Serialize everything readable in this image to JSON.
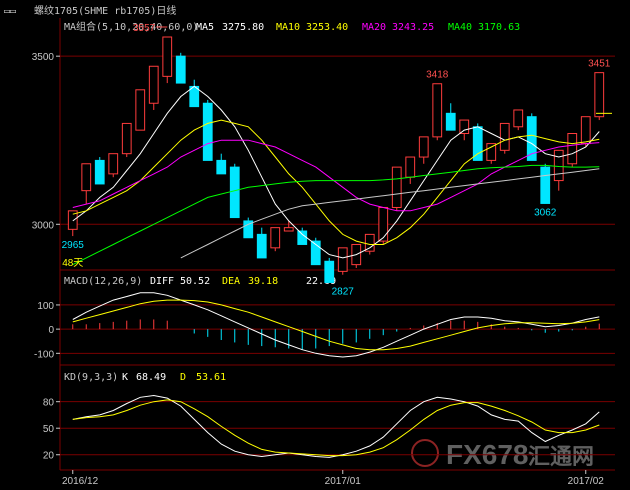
{
  "window": {
    "title": "螺纹1705(SHME rb1705)日线",
    "icon": "window-control-icon"
  },
  "colors": {
    "background": "#000000",
    "up": "#ff3c3c",
    "down": "#00e6ff",
    "grid": "#7a0000",
    "ma5": "#ffffff",
    "ma10": "#ffff00",
    "ma20": "#ff00ff",
    "ma40": "#00ff00",
    "axis_text": "#c8c8c8",
    "label_red": "#ff5050",
    "label_cyan": "#00e6ff"
  },
  "chart_data": [
    {
      "type": "candlestick",
      "title": "螺纹1705(SHME rb1705)日线",
      "ma_header": "MA组合(5,10,20,40,60,0)",
      "ma_values": [
        {
          "name": "MA5",
          "value": "3275.80",
          "color": "#ffffff"
        },
        {
          "name": "MA10",
          "value": "3253.40",
          "color": "#ffff00"
        },
        {
          "name": "MA20",
          "value": "3243.25",
          "color": "#ff00ff"
        },
        {
          "name": "MA40",
          "value": "3170.63",
          "color": "#00ff00"
        }
      ],
      "y_ticks": [
        3500,
        3000
      ],
      "ylim": [
        2870,
        3560
      ],
      "x_labels": [
        {
          "index": 0,
          "text": "2016/12"
        },
        {
          "index": 20,
          "text": "2017/01"
        },
        {
          "index": 38,
          "text": "2017/02"
        }
      ],
      "annotations": [
        {
          "index": 7,
          "value": 3557,
          "text": "3557",
          "color": "#ff5050",
          "arrow": true
        },
        {
          "index": 0,
          "value": 2965,
          "text": "2965",
          "color": "#00e6ff"
        },
        {
          "index": 20,
          "value": 2827,
          "text": "2827",
          "color": "#00e6ff"
        },
        {
          "index": 27,
          "value": 3418,
          "text": "3418",
          "color": "#ff5050"
        },
        {
          "index": 35,
          "value": 3062,
          "text": "3062",
          "color": "#00e6ff"
        },
        {
          "index": 39,
          "value": 3451,
          "text": "3451",
          "color": "#ff5050"
        },
        {
          "index": 0,
          "value": 2890,
          "text": "48天",
          "color": "#ffff00"
        }
      ],
      "candles": [
        {
          "o": 2985,
          "h": 3005,
          "c": 3040,
          "l": 2965
        },
        {
          "o": 3100,
          "h": 3150,
          "c": 3180,
          "l": 3060
        },
        {
          "o": 3190,
          "h": 3120,
          "c": 3120,
          "l": 3200
        },
        {
          "o": 3150,
          "h": 3200,
          "c": 3210,
          "l": 3140
        },
        {
          "o": 3210,
          "h": 3270,
          "c": 3300,
          "l": 3200
        },
        {
          "o": 3280,
          "h": 3370,
          "c": 3400,
          "l": 3280
        },
        {
          "o": 3360,
          "h": 3440,
          "c": 3470,
          "l": 3340
        },
        {
          "o": 3440,
          "h": 3510,
          "c": 3557,
          "l": 3420
        },
        {
          "o": 3500,
          "h": 3420,
          "c": 3420,
          "l": 3510
        },
        {
          "o": 3410,
          "h": 3350,
          "c": 3350,
          "l": 3430
        },
        {
          "o": 3360,
          "h": 3200,
          "c": 3190,
          "l": 3370
        },
        {
          "o": 3190,
          "h": 3160,
          "c": 3150,
          "l": 3210
        },
        {
          "o": 3170,
          "h": 3020,
          "c": 3020,
          "l": 3180
        },
        {
          "o": 3010,
          "h": 2960,
          "c": 2960,
          "l": 3020
        },
        {
          "o": 2970,
          "h": 2920,
          "c": 2900,
          "l": 2990
        },
        {
          "o": 2930,
          "h": 2970,
          "c": 2990,
          "l": 2920
        },
        {
          "o": 2980,
          "h": 2990,
          "c": 2990,
          "l": 3010
        },
        {
          "o": 2980,
          "h": 2950,
          "c": 2940,
          "l": 2990
        },
        {
          "o": 2950,
          "h": 2890,
          "c": 2880,
          "l": 2960
        },
        {
          "o": 2890,
          "h": 2850,
          "c": 2827,
          "l": 2900
        },
        {
          "o": 2860,
          "h": 2900,
          "c": 2930,
          "l": 2850
        },
        {
          "o": 2880,
          "h": 2920,
          "c": 2940,
          "l": 2870
        },
        {
          "o": 2920,
          "h": 2950,
          "c": 2970,
          "l": 2910
        },
        {
          "o": 2950,
          "h": 3030,
          "c": 3050,
          "l": 2940
        },
        {
          "o": 3050,
          "h": 3150,
          "c": 3170,
          "l": 3040
        },
        {
          "o": 3140,
          "h": 3180,
          "c": 3200,
          "l": 3120
        },
        {
          "o": 3200,
          "h": 3240,
          "c": 3260,
          "l": 3180
        },
        {
          "o": 3260,
          "h": 3320,
          "c": 3418,
          "l": 3250
        },
        {
          "o": 3330,
          "h": 3290,
          "c": 3280,
          "l": 3360
        },
        {
          "o": 3270,
          "h": 3300,
          "c": 3310,
          "l": 3250
        },
        {
          "o": 3290,
          "h": 3200,
          "c": 3190,
          "l": 3300
        },
        {
          "o": 3190,
          "h": 3210,
          "c": 3240,
          "l": 3180
        },
        {
          "o": 3220,
          "h": 3290,
          "c": 3300,
          "l": 3210
        },
        {
          "o": 3290,
          "h": 3310,
          "c": 3340,
          "l": 3280
        },
        {
          "o": 3320,
          "h": 3200,
          "c": 3190,
          "l": 3330
        },
        {
          "o": 3170,
          "h": 3120,
          "c": 3062,
          "l": 3180
        },
        {
          "o": 3130,
          "h": 3200,
          "c": 3220,
          "l": 3100
        },
        {
          "o": 3180,
          "h": 3250,
          "c": 3270,
          "l": 3170
        },
        {
          "o": 3240,
          "h": 3300,
          "c": 3320,
          "l": 3230
        },
        {
          "o": 3320,
          "h": 3440,
          "c": 3451,
          "l": 3310
        }
      ],
      "ma_series": [
        {
          "name": "MA5",
          "color": "#ffffff",
          "start": 0,
          "values": [
            3010,
            3040,
            3080,
            3110,
            3160,
            3210,
            3270,
            3330,
            3380,
            3410,
            3380,
            3340,
            3290,
            3220,
            3140,
            3060,
            3010,
            2970,
            2940,
            2910,
            2900,
            2910,
            2930,
            2960,
            3010,
            3070,
            3130,
            3190,
            3250,
            3280,
            3290,
            3270,
            3250,
            3260,
            3240,
            3210,
            3200,
            3210,
            3230,
            3276
          ]
        },
        {
          "name": "MA10",
          "color": "#ffff00",
          "start": 0,
          "values": [
            3030,
            3040,
            3060,
            3080,
            3100,
            3130,
            3170,
            3210,
            3250,
            3280,
            3300,
            3310,
            3300,
            3290,
            3250,
            3200,
            3150,
            3110,
            3060,
            3010,
            2970,
            2950,
            2940,
            2940,
            2960,
            2990,
            3030,
            3080,
            3130,
            3180,
            3210,
            3230,
            3250,
            3260,
            3265,
            3255,
            3245,
            3240,
            3245,
            3253
          ]
        },
        {
          "name": "MA20",
          "color": "#ff00ff",
          "start": 0,
          "values": [
            3050,
            3060,
            3070,
            3090,
            3110,
            3130,
            3150,
            3170,
            3200,
            3220,
            3240,
            3250,
            3250,
            3250,
            3240,
            3230,
            3210,
            3190,
            3170,
            3140,
            3110,
            3080,
            3060,
            3050,
            3040,
            3040,
            3050,
            3060,
            3080,
            3100,
            3120,
            3150,
            3170,
            3190,
            3210,
            3220,
            3230,
            3235,
            3240,
            3243
          ]
        },
        {
          "name": "MA40",
          "color": "#00ff00",
          "start": 0,
          "values": [
            2880,
            2900,
            2920,
            2940,
            2960,
            2980,
            3000,
            3020,
            3040,
            3060,
            3080,
            3090,
            3100,
            3110,
            3115,
            3120,
            3125,
            3128,
            3130,
            3130,
            3130,
            3130,
            3130,
            3132,
            3135,
            3140,
            3145,
            3150,
            3155,
            3160,
            3165,
            3168,
            3170,
            3172,
            3175,
            3175,
            3172,
            3170,
            3170,
            3171
          ]
        },
        {
          "name": "MA60",
          "color": "#c8c8c8",
          "start": 8,
          "values": [
            2900,
            2920,
            2940,
            2960,
            2980,
            3000,
            3015,
            3030,
            3045,
            3055,
            3060,
            3065,
            3070,
            3075,
            3080,
            3085,
            3090,
            3095,
            3100,
            3105,
            3110,
            3115,
            3120,
            3125,
            3130,
            3135,
            3140,
            3145,
            3150,
            3155,
            3160,
            3165
          ]
        }
      ]
    },
    {
      "type": "macd",
      "header": "MACD(12,26,9)",
      "diff_label": "DIFF",
      "diff_value": "50.52",
      "dea_label": "DEA",
      "dea_value": "39.18",
      "macd_value": "22.69",
      "y_ticks": [
        100,
        0,
        -100
      ],
      "ylim": [
        -140,
        170
      ],
      "diff": [
        40,
        70,
        95,
        120,
        135,
        150,
        150,
        140,
        120,
        100,
        80,
        55,
        30,
        5,
        -20,
        -45,
        -65,
        -85,
        -100,
        -110,
        -115,
        -110,
        -95,
        -75,
        -50,
        -25,
        0,
        20,
        40,
        50,
        50,
        45,
        35,
        30,
        20,
        10,
        15,
        25,
        40,
        50.52
      ],
      "dea": [
        30,
        45,
        60,
        75,
        90,
        105,
        115,
        120,
        120,
        118,
        112,
        100,
        85,
        70,
        50,
        30,
        10,
        -10,
        -30,
        -50,
        -65,
        -80,
        -85,
        -85,
        -80,
        -70,
        -55,
        -40,
        -25,
        -10,
        5,
        15,
        22,
        26,
        26,
        24,
        22,
        24,
        30,
        39.18
      ],
      "hist": [
        20,
        20,
        25,
        30,
        35,
        40,
        40,
        35,
        0,
        -18,
        -32,
        -45,
        -55,
        -65,
        -70,
        -75,
        -80,
        -85,
        -80,
        -70,
        -60,
        -55,
        -40,
        -25,
        -10,
        5,
        15,
        25,
        35,
        35,
        30,
        20,
        10,
        5,
        -5,
        -15,
        -10,
        -5,
        10,
        22.69
      ]
    },
    {
      "type": "kd",
      "header": "KD(9,3,3)",
      "k_label": "K",
      "k_value": "68.49",
      "d_label": "D",
      "d_value": "53.61",
      "y_ticks": [
        80,
        50,
        20
      ],
      "ylim": [
        5,
        100
      ],
      "k": [
        60,
        63,
        65,
        70,
        78,
        85,
        87,
        84,
        75,
        60,
        45,
        32,
        24,
        20,
        18,
        20,
        22,
        20,
        18,
        17,
        20,
        24,
        30,
        40,
        55,
        70,
        80,
        85,
        83,
        80,
        75,
        65,
        60,
        58,
        45,
        35,
        42,
        48,
        55,
        68.49
      ],
      "d": [
        60,
        62,
        63,
        65,
        70,
        76,
        80,
        82,
        80,
        72,
        63,
        52,
        42,
        33,
        26,
        23,
        22,
        21,
        20,
        19,
        19,
        20,
        23,
        28,
        37,
        48,
        60,
        70,
        76,
        79,
        79,
        75,
        70,
        64,
        57,
        48,
        45,
        45,
        48,
        53.61
      ]
    }
  ],
  "watermark": {
    "text": "FX678",
    "suffix": "汇通网"
  }
}
